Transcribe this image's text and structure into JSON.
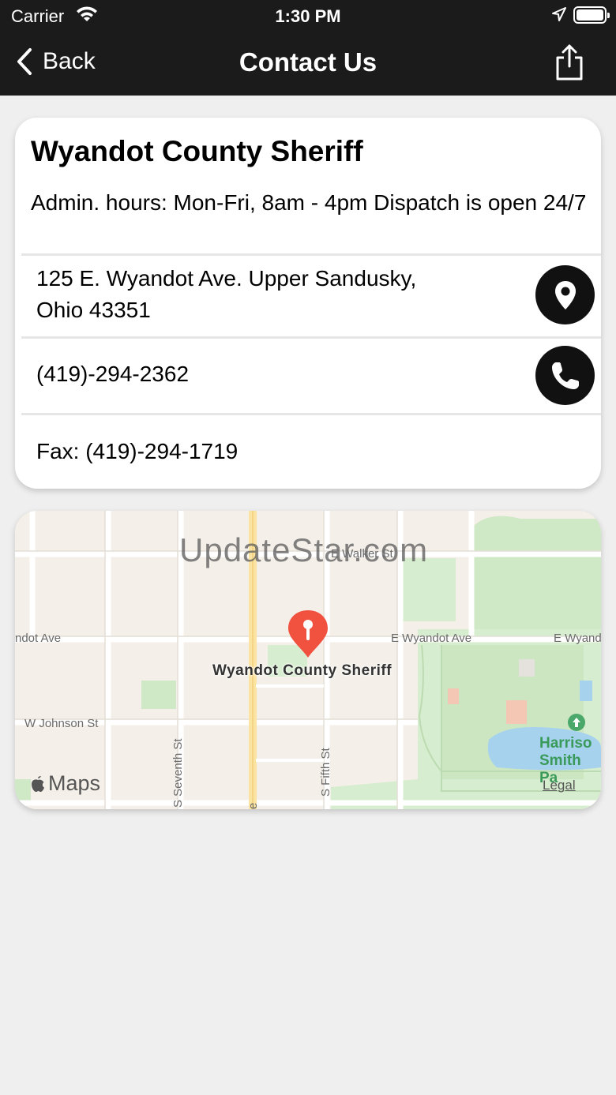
{
  "status_bar": {
    "carrier": "Carrier",
    "time": "1:30 PM"
  },
  "nav": {
    "back_label": "Back",
    "title": "Contact Us"
  },
  "contact": {
    "name": "Wyandot County Sheriff",
    "hours": "Admin. hours: Mon-Fri, 8am - 4pm Dispatch is open 24/7",
    "address_line1": "125 E. Wyandot Ave. Upper Sandusky,",
    "address_line2": "Ohio 43351",
    "phone": "(419)-294-2362",
    "fax": "Fax: (419)-294-1719"
  },
  "map": {
    "watermark": "UpdateStar.com",
    "pin_label": "Wyandot County Sheriff",
    "streets": {
      "walker": "E Walker St",
      "wyandot_left": "ndot Ave",
      "wyandot_east": "E Wyandot Ave",
      "wyandot_far": "E Wyand",
      "johnson": "W Johnson St",
      "seventh": "S Seventh St",
      "fifth": "S Fifth St",
      "partial_e": "e"
    },
    "park_line1": "Harriso",
    "park_line2": "Smith Pa",
    "logo_text": "Maps",
    "legal": "Legal"
  },
  "colors": {
    "nav_background": "#1b1b1b",
    "pin": "#f0523f",
    "park": "#cfe8c6",
    "water": "#a6d2ee"
  }
}
